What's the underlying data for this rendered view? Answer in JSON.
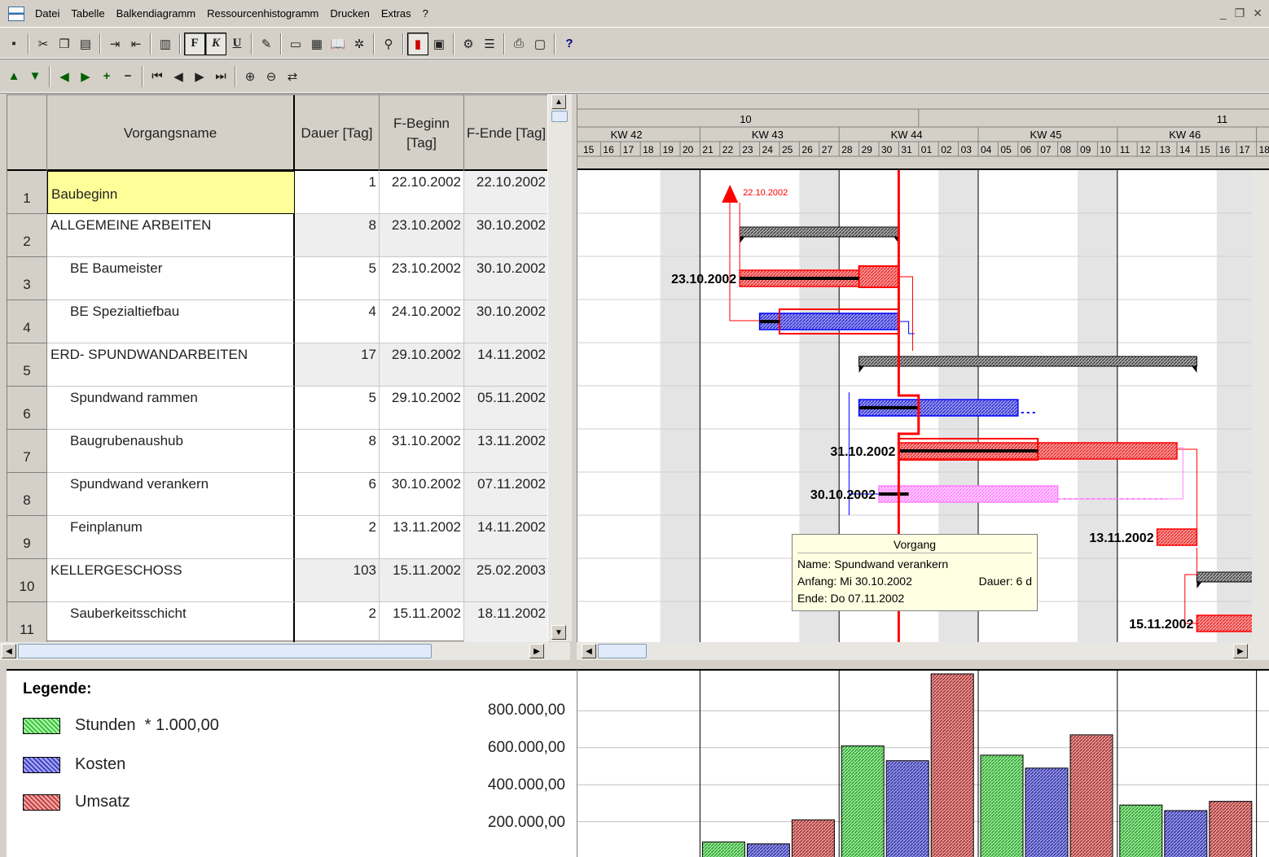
{
  "menubar": {
    "items": [
      "Datei",
      "Tabelle",
      "Balkendiagramm",
      "Ressourcenhistogramm",
      "Drucken",
      "Extras",
      "?"
    ]
  },
  "table": {
    "columns": {
      "name": "Vorgangsname",
      "duration": "Dauer [Tag]",
      "start": "F-Beginn [Tag]",
      "end": "F-Ende [Tag]"
    },
    "rows": [
      {
        "num": "1",
        "name": "Baubeginn",
        "duration": "1",
        "start": "22.10.2002",
        "end": "22.10.2002",
        "summary": false
      },
      {
        "num": "2",
        "name": "ALLGEMEINE ARBEITEN",
        "duration": "8",
        "start": "23.10.2002",
        "end": "30.10.2002",
        "summary": true
      },
      {
        "num": "3",
        "name": "BE Baumeister",
        "duration": "5",
        "start": "23.10.2002",
        "end": "30.10.2002",
        "summary": false
      },
      {
        "num": "4",
        "name": "BE Spezialtiefbau",
        "duration": "4",
        "start": "24.10.2002",
        "end": "30.10.2002",
        "summary": false
      },
      {
        "num": "5",
        "name": "ERD- SPUNDWANDARBEITEN",
        "duration": "17",
        "start": "29.10.2002",
        "end": "14.11.2002",
        "summary": true
      },
      {
        "num": "6",
        "name": "Spundwand rammen",
        "duration": "5",
        "start": "29.10.2002",
        "end": "05.11.2002",
        "summary": false
      },
      {
        "num": "7",
        "name": "Baugrubenaushub",
        "duration": "8",
        "start": "31.10.2002",
        "end": "13.11.2002",
        "summary": false
      },
      {
        "num": "8",
        "name": "Spundwand verankern",
        "duration": "6",
        "start": "30.10.2002",
        "end": "07.11.2002",
        "summary": false
      },
      {
        "num": "9",
        "name": "Feinplanum",
        "duration": "2",
        "start": "13.11.2002",
        "end": "14.11.2002",
        "summary": false
      },
      {
        "num": "10",
        "name": "KELLERGESCHOSS",
        "duration": "103",
        "start": "15.11.2002",
        "end": "25.02.2003",
        "summary": true
      },
      {
        "num": "11",
        "name": "Sauberkeitsschicht",
        "duration": "2",
        "start": "15.11.2002",
        "end": "18.11.2002",
        "summary": false
      }
    ]
  },
  "gantt": {
    "months": [
      "10",
      "11"
    ],
    "weeks": [
      "KW 42",
      "KW 43",
      "KW 44",
      "KW 45",
      "KW 46"
    ],
    "days": [
      "15",
      "16",
      "17",
      "18",
      "19",
      "20",
      "21",
      "22",
      "23",
      "24",
      "25",
      "26",
      "27",
      "28",
      "29",
      "30",
      "31",
      "01",
      "02",
      "03",
      "04",
      "05",
      "06",
      "07",
      "08",
      "09",
      "10",
      "11",
      "12",
      "13",
      "14",
      "15",
      "16",
      "17",
      "18"
    ],
    "milestone_label": "22.10.2002",
    "bar_labels": [
      "23.10.2002",
      "31.10.2002",
      "30.10.2002",
      "13.11.2002",
      "15.11.2002"
    ]
  },
  "tooltip": {
    "title": "Vorgang",
    "name": "Name: Spundwand verankern",
    "start": "Anfang: Mi 30.10.2002",
    "duration": "Dauer: 6 d",
    "end": "Ende: Do 07.11.2002"
  },
  "legend": {
    "title": "Legende:",
    "items": [
      {
        "label": "Stunden  * 1.000,00",
        "color": "#44bb44"
      },
      {
        "label": "Kosten",
        "color": "#4444bb"
      },
      {
        "label": "Umsatz",
        "color": "#bb4444"
      }
    ],
    "yticks": [
      "800.000,00",
      "600.000,00",
      "400.000,00",
      "200.000,00"
    ]
  },
  "chart_data": {
    "type": "bar",
    "categories": [
      "KW 42",
      "KW 43",
      "KW 44",
      "KW 45",
      "KW 46"
    ],
    "series": [
      {
        "name": "Stunden",
        "values": [
          0,
          90000,
          610000,
          560000,
          290000
        ]
      },
      {
        "name": "Kosten",
        "values": [
          0,
          80000,
          530000,
          490000,
          260000
        ]
      },
      {
        "name": "Umsatz",
        "values": [
          0,
          210000,
          1000000,
          670000,
          310000
        ]
      }
    ],
    "yticks": [
      "800.000,00",
      "600.000,00",
      "400.000,00",
      "200.000,00"
    ]
  }
}
